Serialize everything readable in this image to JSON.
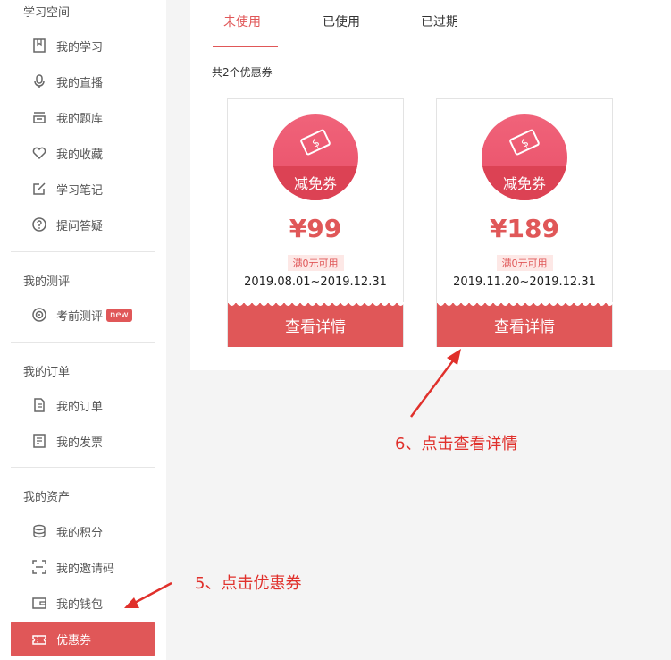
{
  "sidebar": {
    "sections": [
      {
        "title": "学习空间",
        "items": [
          "我的学习",
          "我的直播",
          "我的题库",
          "我的收藏",
          "学习笔记",
          "提问答疑"
        ]
      },
      {
        "title": "我的测评",
        "items": [
          "考前测评"
        ],
        "badge": "new"
      },
      {
        "title": "我的订单",
        "items": [
          "我的订单",
          "我的发票"
        ]
      },
      {
        "title": "我的资产",
        "items": [
          "我的积分",
          "我的邀请码",
          "我的钱包",
          "优惠券"
        ]
      }
    ]
  },
  "tabs": [
    "未使用",
    "已使用",
    "已过期"
  ],
  "active_tab": "未使用",
  "coupon_count": "共2个优惠券",
  "coupons": [
    {
      "type": "减免券",
      "price": "¥99",
      "condition": "满0元可用",
      "dates": "2019.08.01~2019.12.31",
      "button": "查看详情"
    },
    {
      "type": "减免券",
      "price": "¥189",
      "condition": "满0元可用",
      "dates": "2019.11.20~2019.12.31",
      "button": "查看详情"
    }
  ],
  "annotations": {
    "step5": "5、点击优惠券",
    "step6": "6、点击查看详情"
  },
  "colors": {
    "accent": "#e05758",
    "annotation": "#e0302b"
  }
}
